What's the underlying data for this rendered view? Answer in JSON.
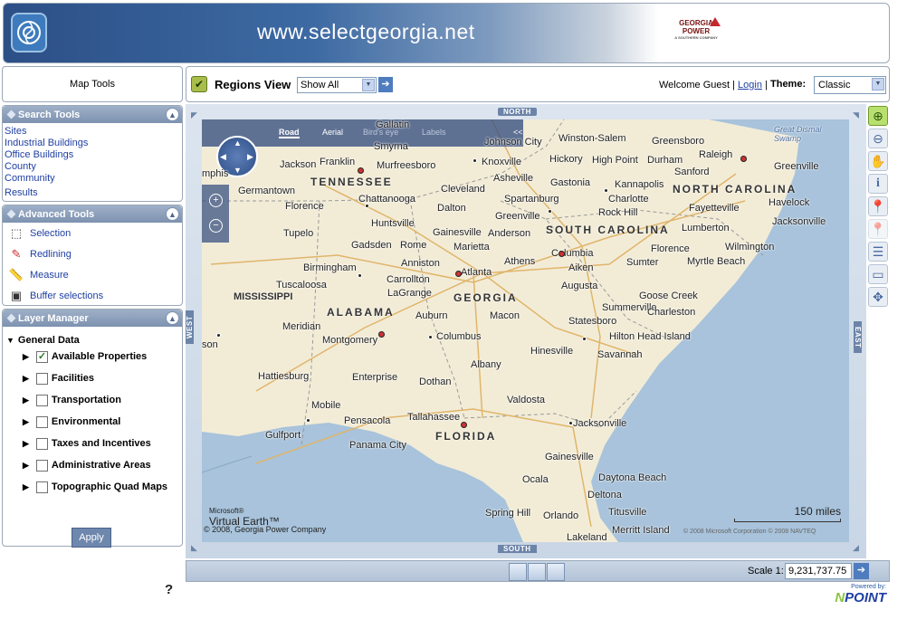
{
  "banner": {
    "url": "www.selectgeorgia.net",
    "partner_line1": "GEORGIA",
    "partner_line2": "POWER",
    "partner_line3": "A SOUTHERN COMPANY"
  },
  "left": {
    "map_tools_title": "Map Tools",
    "search": {
      "title": "Search Tools",
      "links": [
        "Sites",
        "Industrial Buildings",
        "Office Buildings",
        "County",
        "Community",
        "Results"
      ]
    },
    "advanced": {
      "title": "Advanced Tools",
      "items": [
        {
          "label": "Selection",
          "icon": "selection-icon"
        },
        {
          "label": "Redlining",
          "icon": "redlining-icon"
        },
        {
          "label": "Measure",
          "icon": "measure-icon"
        },
        {
          "label": "Buffer selections",
          "icon": "buffer-icon"
        }
      ]
    },
    "layers": {
      "title": "Layer Manager",
      "group": "General Data",
      "items": [
        {
          "label": "Available Properties",
          "checked": true
        },
        {
          "label": "Facilities",
          "checked": false
        },
        {
          "label": "Transportation",
          "checked": false
        },
        {
          "label": "Environmental",
          "checked": false
        },
        {
          "label": "Taxes and Incentives",
          "checked": false
        },
        {
          "label": "Administrative Areas",
          "checked": false
        },
        {
          "label": "Topographic Quad Maps",
          "checked": false
        }
      ]
    },
    "apply_label": "Apply",
    "help": "?"
  },
  "topbar": {
    "title": "Regions View",
    "select_value": "Show All",
    "welcome": "Welcome Guest |",
    "login": "Login",
    "sep": "|",
    "theme_label": "Theme:",
    "theme_value": "Classic"
  },
  "map": {
    "directions": {
      "north": "NORTH",
      "south": "SOUTH",
      "west": "WEST",
      "east": "EAST"
    },
    "styles": {
      "road": "Road",
      "aerial": "Aerial",
      "birdseye": "Bird's eye",
      "labels": "Labels",
      "collapse": "<<"
    },
    "states": [
      "TENNESSEE",
      "NORTH CAROLINA",
      "SOUTH CAROLINA",
      "GEORGIA",
      "ALABAMA",
      "MISSISSIPPI",
      "FLORIDA"
    ],
    "cities": [
      "Gallatin",
      "Smyrna",
      "Murfreesboro",
      "Jackson",
      "Franklin",
      "Knoxville",
      "Johnson City",
      "Winston-Salem",
      "Greensboro",
      "Raleigh",
      "Durham",
      "High Point",
      "Hickory",
      "Sanford",
      "Greenville",
      "Asheville",
      "Gastonia",
      "Kannapolis",
      "Charlotte",
      "Rock Hill",
      "Fayetteville",
      "Havelock",
      "Jacksonville",
      "Lumberton",
      "Wilmington",
      "Florence",
      "Myrtle Beach",
      "Sumter",
      "Columbia",
      "Aiken",
      "Augusta",
      "Greenville",
      "Spartanburg",
      "Anderson",
      "Gainesville",
      "Dalton",
      "Cleveland",
      "Chattanooga",
      "Huntsville",
      "Florence",
      "Germantown",
      "Tupelo",
      "Gadsden",
      "Rome",
      "Marietta",
      "Atlanta",
      "Athens",
      "Birmingham",
      "Anniston",
      "Carrollton",
      "Tuscaloosa",
      "LaGrange",
      "Macon",
      "Auburn",
      "Montgomery",
      "Meridian",
      "Columbus",
      "Summerville",
      "Goose Creek",
      "Charleston",
      "Statesboro",
      "Hilton Head Island",
      "Savannah",
      "Hinesville",
      "Albany",
      "Enterprise",
      "Dothan",
      "Hattiesburg",
      "Mobile",
      "Pensacola",
      "Tallahassee",
      "Valdosta",
      "Jacksonville",
      "Gulfport",
      "Panama City",
      "Gainesville",
      "Ocala",
      "Daytona Beach",
      "Deltona",
      "Spring Hill",
      "Orlando",
      "Titusville",
      "Merritt Island",
      "Lakeland",
      "mphis",
      "son",
      "Great Dismal Swamp"
    ],
    "scale_text": "150 miles",
    "ve_brand": "Microsoft®",
    "ve_name": "Virtual Earth™",
    "copyright": "© 2008, Georgia Power Company",
    "ms_copyright": "© 2008 Microsoft Corporation     © 2008 NAVTEQ"
  },
  "right_tools": [
    "zoom-in-icon",
    "zoom-out-icon",
    "pan-hand-icon",
    "info-icon",
    "pin-icon",
    "pin-disabled-icon",
    "layers-list-icon",
    "overview-icon",
    "navigate-icon"
  ],
  "bottombar": {
    "scale_label": "Scale 1:",
    "scale_value": "9,231,737.75"
  },
  "footer": {
    "powered": "Powered by:",
    "brand_n": "N",
    "brand_rest": "POINT"
  }
}
